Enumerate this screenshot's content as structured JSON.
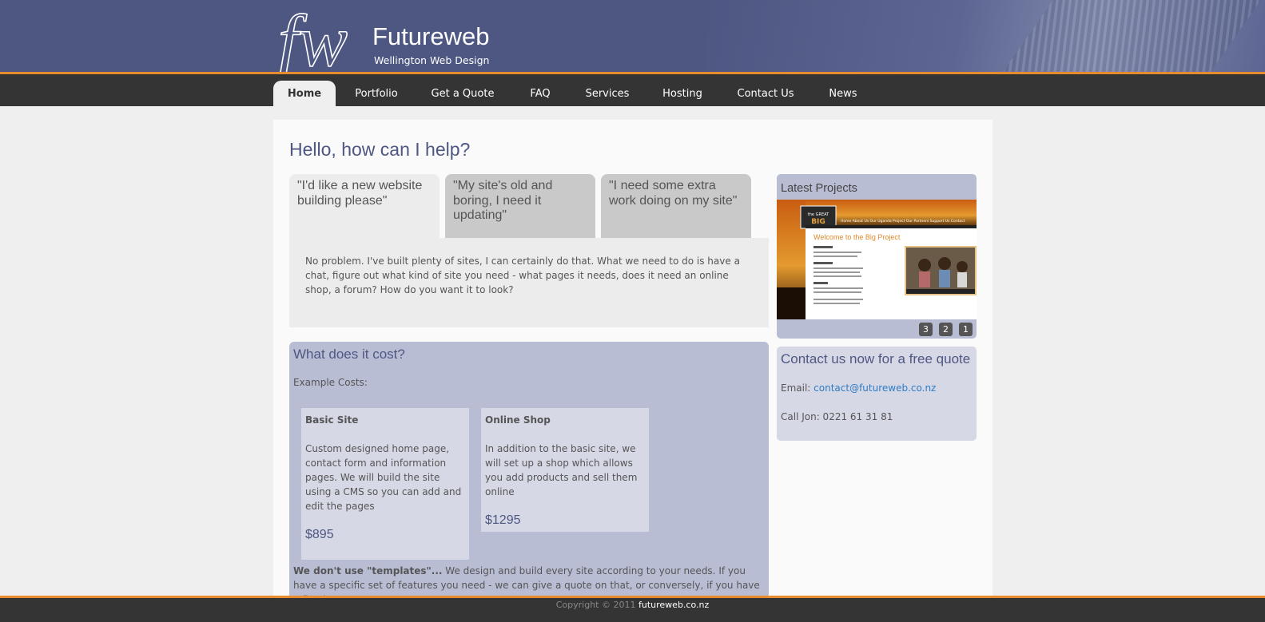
{
  "header": {
    "brand": "Futureweb",
    "tagline": "Wellington Web Design",
    "logo_text": "fw"
  },
  "nav": {
    "items": [
      {
        "label": "Home",
        "active": true
      },
      {
        "label": "Portfolio"
      },
      {
        "label": "Get a Quote"
      },
      {
        "label": "FAQ"
      },
      {
        "label": "Services"
      },
      {
        "label": "Hosting"
      },
      {
        "label": "Contact Us"
      },
      {
        "label": "News"
      }
    ]
  },
  "main": {
    "title": "Hello, how can I help?",
    "tabs": [
      {
        "label": "\"I'd like a new website building please\"",
        "active": true
      },
      {
        "label": "\"My site's old and boring, I need it updating\""
      },
      {
        "label": "\"I need some extra work doing on my site\""
      }
    ],
    "tab_content": "No problem. I've built plenty of sites, I can certainly do that. What we need to do is have a chat, figure out what kind of site you need - what pages it needs, does it need an online shop, a forum? How do you want it to look?",
    "cost": {
      "title": "What does it cost?",
      "intro": "Example Costs:",
      "items": [
        {
          "name": "Basic Site",
          "description": "Custom designed home page, contact form and information pages. We will build the site using a CMS so you can add and edit the pages",
          "price": "$895"
        },
        {
          "name": "Online Shop",
          "description": "In addition to the basic site, we will set up a shop which allows you add products and sell them online",
          "price": "$1295"
        }
      ],
      "note_bold": "We don't use \"templates\"...",
      "note_text": " We design and build every site according to your needs. If you have a specific set of features you need - we can give a quote on that, or conversely, if you have a fixed"
    }
  },
  "sidebar": {
    "projects": {
      "title": "Latest Projects",
      "pager": [
        "3",
        "2",
        "1"
      ],
      "screenshot": {
        "logo": "the GREAT BIG PROJECT",
        "nav": "Home  About Us  Our Uganda Project  Our Partners  Support Us  Contact",
        "heading": "Welcome to the Big Project"
      }
    },
    "contact": {
      "title": "Contact us now for a free quote",
      "email_label": "Email:",
      "email": "contact@futureweb.co.nz",
      "phone": "Call Jon: 0221 61 31 81"
    }
  },
  "footer": {
    "copyright": "Copyright © 2011",
    "site": "futureweb.co.nz"
  },
  "colors": {
    "header_bg": "#4e5782",
    "accent_orange": "#e88a2e",
    "nav_bg": "#343434",
    "panel_lavender": "#b9bdd4",
    "card_light": "#d6d8e5",
    "link_blue": "#2e7bc4"
  }
}
